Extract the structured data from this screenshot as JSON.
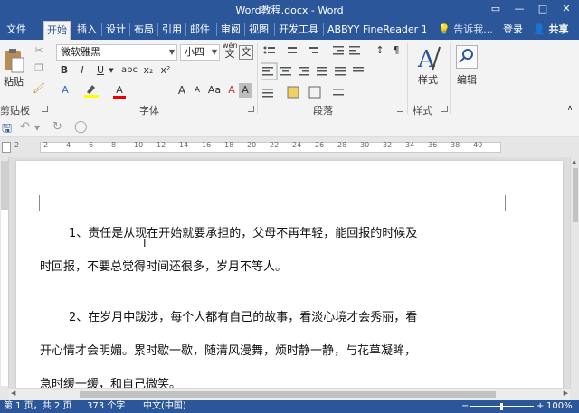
{
  "window": {
    "title": "Word教程.docx - Word",
    "controls": [
      "▭",
      "—",
      "□",
      "✕"
    ]
  },
  "tabs": {
    "file": "文件",
    "items": [
      "开始",
      "插入",
      "设计",
      "布局",
      "引用",
      "邮件",
      "审阅",
      "视图",
      "开发工具",
      "ABBYY FineReader 1’"
    ],
    "active": "开始",
    "tell_me": "告诉我...",
    "login": "登录",
    "share": "共享"
  },
  "ribbon": {
    "clipboard": {
      "label": "剪贴板",
      "paste": "粘贴"
    },
    "font": {
      "label": "字体",
      "font_name": "微软雅黑",
      "font_size": "小四",
      "wen": "wén",
      "wen_char": "文",
      "bold": "B",
      "italic": "I",
      "underline": "U",
      "strike": "abc",
      "sub": "x₂",
      "sup": "x²",
      "grow": "A",
      "shrink": "A",
      "aa": "Aa",
      "clear": "A",
      "char_border": "A",
      "font_color": "A",
      "shade": "A"
    },
    "paragraph": {
      "label": "段落"
    },
    "styles": {
      "label": "样式",
      "button": "样式"
    },
    "editing": {
      "label": "",
      "button": "编辑"
    }
  },
  "ruler": {
    "numbers": [
      "2",
      "2",
      "4",
      "6",
      "8",
      "10",
      "12",
      "14",
      "16",
      "18",
      "20",
      "22",
      "24",
      "26",
      "28",
      "30",
      "32",
      "34",
      "36",
      "38",
      "40"
    ]
  },
  "document": {
    "paragraphs": [
      {
        "line1": "1、责任是从现在开始就要承担的，父母不再年轻，能回报的时候及",
        "line2": "时回报，不要总觉得时间还很多，岁月不等人。"
      },
      {
        "line1": "2、在岁月中跋涉，每个人都有自己的故事，看淡心境才会秀丽，看",
        "line2": "开心情才会明媚。累时歇一歇，随清风漫舞，烦时静一静，与花草凝眸，",
        "line3": "急时缓一缓，和自己微笑。"
      }
    ]
  },
  "status": {
    "page": "第 1 页，共 2 页",
    "words": "373 个字",
    "language": "中文(中国)",
    "zoom": "100%"
  },
  "colors": {
    "accent": "#2b579a",
    "ribbon_bg": "#f3f3f3",
    "doc_bg": "#dedede"
  }
}
